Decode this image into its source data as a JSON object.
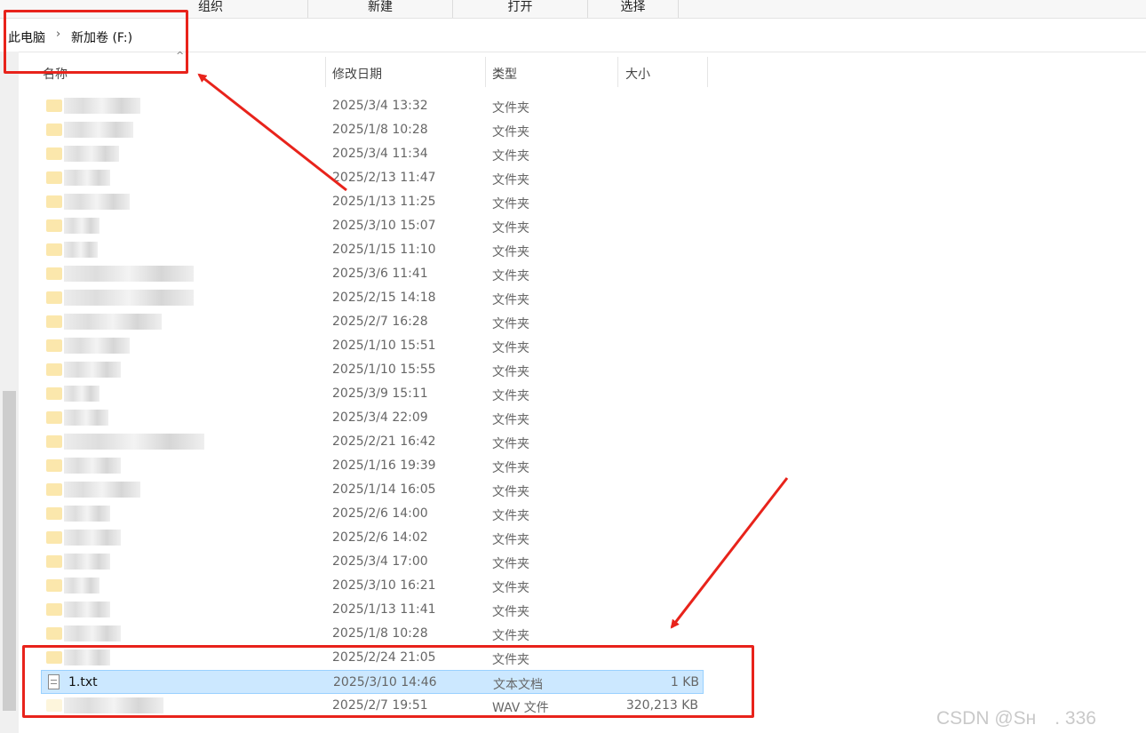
{
  "ribbon": {
    "groups": [
      "组织",
      "新建",
      "打开",
      "选择"
    ]
  },
  "address_bar": {
    "crumbs": [
      "此电脑",
      "新加卷 (F:)"
    ],
    "separator": "›"
  },
  "columns": {
    "name": "名称",
    "modified": "修改日期",
    "type": "类型",
    "size": "大小"
  },
  "rows": [
    {
      "name": "",
      "modified": "2025/3/4 13:32",
      "type": "文件夹",
      "size": "",
      "icon": "folder-icon"
    },
    {
      "name": "",
      "modified": "2025/1/8 10:28",
      "type": "文件夹",
      "size": "",
      "icon": "folder-icon"
    },
    {
      "name": "",
      "modified": "2025/3/4 11:34",
      "type": "文件夹",
      "size": "",
      "icon": "folder-icon"
    },
    {
      "name": "",
      "modified": "2025/2/13 11:47",
      "type": "文件夹",
      "size": "",
      "icon": "folder-icon"
    },
    {
      "name": "",
      "modified": "2025/1/13 11:25",
      "type": "文件夹",
      "size": "",
      "icon": "folder-icon"
    },
    {
      "name": "",
      "modified": "2025/3/10 15:07",
      "type": "文件夹",
      "size": "",
      "icon": "folder-icon"
    },
    {
      "name": "",
      "modified": "2025/1/15 11:10",
      "type": "文件夹",
      "size": "",
      "icon": "folder-icon"
    },
    {
      "name": "",
      "modified": "2025/3/6 11:41",
      "type": "文件夹",
      "size": "",
      "icon": "folder-icon"
    },
    {
      "name": "",
      "modified": "2025/2/15 14:18",
      "type": "文件夹",
      "size": "",
      "icon": "folder-icon"
    },
    {
      "name": "",
      "modified": "2025/2/7 16:28",
      "type": "文件夹",
      "size": "",
      "icon": "folder-icon"
    },
    {
      "name": "",
      "modified": "2025/1/10 15:51",
      "type": "文件夹",
      "size": "",
      "icon": "folder-icon"
    },
    {
      "name": "",
      "modified": "2025/1/10 15:55",
      "type": "文件夹",
      "size": "",
      "icon": "folder-icon"
    },
    {
      "name": "",
      "modified": "2025/3/9 15:11",
      "type": "文件夹",
      "size": "",
      "icon": "folder-icon"
    },
    {
      "name": "",
      "modified": "2025/3/4 22:09",
      "type": "文件夹",
      "size": "",
      "icon": "folder-icon"
    },
    {
      "name": "",
      "modified": "2025/2/21 16:42",
      "type": "文件夹",
      "size": "",
      "icon": "folder-icon"
    },
    {
      "name": "",
      "modified": "2025/1/16 19:39",
      "type": "文件夹",
      "size": "",
      "icon": "folder-icon"
    },
    {
      "name": "",
      "modified": "2025/1/14 16:05",
      "type": "文件夹",
      "size": "",
      "icon": "folder-icon"
    },
    {
      "name": "",
      "modified": "2025/2/6 14:00",
      "type": "文件夹",
      "size": "",
      "icon": "folder-icon"
    },
    {
      "name": "",
      "modified": "2025/2/6 14:02",
      "type": "文件夹",
      "size": "",
      "icon": "folder-icon"
    },
    {
      "name": "",
      "modified": "2025/3/4 17:00",
      "type": "文件夹",
      "size": "",
      "icon": "folder-icon"
    },
    {
      "name": "",
      "modified": "2025/3/10 16:21",
      "type": "文件夹",
      "size": "",
      "icon": "folder-icon"
    },
    {
      "name": "",
      "modified": "2025/1/13 11:41",
      "type": "文件夹",
      "size": "",
      "icon": "folder-icon"
    },
    {
      "name": "",
      "modified": "2025/1/8 10:28",
      "type": "文件夹",
      "size": "",
      "icon": "folder-icon"
    },
    {
      "name": "",
      "modified": "2025/2/24 21:05",
      "type": "文件夹",
      "size": "",
      "icon": "folder-icon"
    },
    {
      "name": "1.txt",
      "modified": "2025/3/10 14:46",
      "type": "文本文档",
      "size": "1 KB",
      "icon": "text-file-icon",
      "selected": true
    },
    {
      "name": "",
      "modified": "2025/2/7 19:51",
      "type": "WAV 文件",
      "size": "320,213 KB",
      "icon": "audio-file-icon"
    }
  ],
  "watermark": "CSDN @Sн　. 336",
  "colors": {
    "annotation": "#e8231b",
    "selection_bg": "#cce8ff",
    "selection_border": "#99d1ff"
  }
}
